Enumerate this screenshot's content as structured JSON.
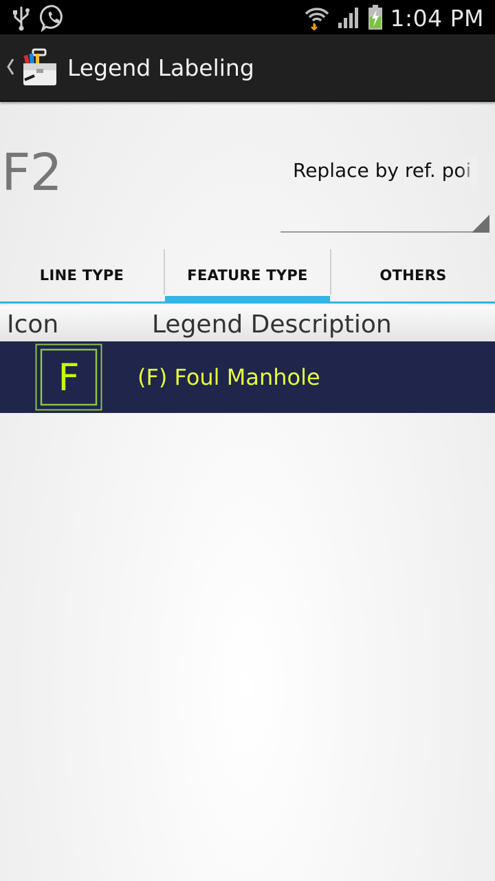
{
  "status_bar": {
    "time": "1:04 PM",
    "left_icons": [
      "usb-icon",
      "whatsapp-icon"
    ],
    "right_icons": [
      "wifi-icon",
      "signal-icon",
      "battery-charging-icon"
    ]
  },
  "action_bar": {
    "title": "Legend Labeling",
    "up_icon": "chevron-left-icon",
    "app_icon": "toolbox-icon"
  },
  "header": {
    "code": "F2",
    "spinner_selected": "Replace by ref. poi"
  },
  "tabs": [
    {
      "label": "LINE TYPE",
      "selected": false
    },
    {
      "label": "FEATURE TYPE",
      "selected": true
    },
    {
      "label": "OTHERS",
      "selected": false
    }
  ],
  "list_header": {
    "icon_col": "Icon",
    "desc_col": "Legend Description"
  },
  "legend_items": [
    {
      "icon_letter": "F",
      "description": "(F) Foul Manhole"
    }
  ],
  "colors": {
    "accent": "#33b5e5",
    "row_bg": "#1f254b",
    "row_text": "#e5ff3a",
    "icon_stroke": "#8bc34a"
  }
}
